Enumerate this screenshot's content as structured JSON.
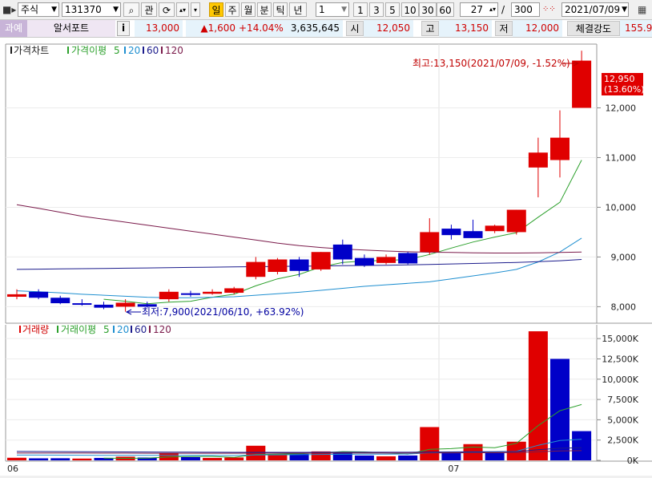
{
  "toolbar": {
    "market": "주식",
    "code": "131370",
    "btn_interest": "관",
    "periods": [
      "일",
      "주",
      "월",
      "분",
      "틱",
      "년"
    ],
    "interval_select": "1",
    "intervals": [
      "1",
      "3",
      "5",
      "10",
      "30",
      "60"
    ],
    "count_value": "27",
    "count_total": "300",
    "date": "2021/07/09"
  },
  "quote": {
    "badge": "과예",
    "name": "알서포트",
    "info": "i",
    "price": "13,000",
    "change": "▲1,600",
    "change_pct": "+14.04%",
    "volume": "3,635,645",
    "open_label": "시",
    "open": "12,050",
    "high_label": "고",
    "high": "13,150",
    "low_label": "저",
    "low": "12,000",
    "strength_label": "체결강도",
    "strength": "155.9"
  },
  "colors": {
    "up": "#e00000",
    "down": "#0000c8",
    "ma5": "#2ca02c",
    "ma20": "#1f8fd0",
    "ma60": "#1c1c8c",
    "ma120": "#7a1a4a"
  },
  "legends": {
    "price": {
      "title": "가격차트",
      "ma_label": "가격이평",
      "ma": [
        "5",
        "20",
        "60",
        "120"
      ]
    },
    "volume": {
      "title": "거래량",
      "ma_label": "거래이평",
      "ma": [
        "5",
        "20",
        "60",
        "120"
      ]
    }
  },
  "chart_data": [
    {
      "type": "candlestick",
      "title": "가격차트",
      "ylim": [
        7700,
        13250
      ],
      "y_ticks": [
        8000,
        9000,
        10000,
        11000,
        12000
      ],
      "y_tick_labels": [
        "8,000",
        "9,000",
        "10,000",
        "11,000",
        "12,000"
      ],
      "x_labels": [
        {
          "index": 0,
          "label": "06"
        },
        {
          "index": 20,
          "label": "07"
        }
      ],
      "last_price": "12,950",
      "last_pct": "(13.60%)",
      "annotation_high": "최고:13,150(2021/07/09, -1.52%)",
      "annotation_low": "최저:7,900(2021/06/10, +63.92%)",
      "candles": [
        {
          "o": 8200,
          "h": 8350,
          "l": 8150,
          "c": 8250
        },
        {
          "o": 8300,
          "h": 8350,
          "l": 8150,
          "c": 8180
        },
        {
          "o": 8180,
          "h": 8220,
          "l": 8050,
          "c": 8070
        },
        {
          "o": 8070,
          "h": 8150,
          "l": 8020,
          "c": 8040
        },
        {
          "o": 8040,
          "h": 8100,
          "l": 7950,
          "c": 7980
        },
        {
          "o": 8000,
          "h": 8150,
          "l": 7900,
          "c": 8080
        },
        {
          "o": 8050,
          "h": 8100,
          "l": 7980,
          "c": 8000
        },
        {
          "o": 8150,
          "h": 8350,
          "l": 8100,
          "c": 8300
        },
        {
          "o": 8270,
          "h": 8320,
          "l": 8200,
          "c": 8260
        },
        {
          "o": 8260,
          "h": 8350,
          "l": 8240,
          "c": 8300
        },
        {
          "o": 8280,
          "h": 8400,
          "l": 8250,
          "c": 8370
        },
        {
          "o": 8600,
          "h": 9000,
          "l": 8550,
          "c": 8900
        },
        {
          "o": 8700,
          "h": 8980,
          "l": 8650,
          "c": 8950
        },
        {
          "o": 8950,
          "h": 9000,
          "l": 8600,
          "c": 8720
        },
        {
          "o": 8750,
          "h": 9100,
          "l": 8720,
          "c": 9100
        },
        {
          "o": 9250,
          "h": 9350,
          "l": 8850,
          "c": 8950
        },
        {
          "o": 8980,
          "h": 9050,
          "l": 8800,
          "c": 8830
        },
        {
          "o": 8880,
          "h": 9050,
          "l": 8850,
          "c": 9000
        },
        {
          "o": 9080,
          "h": 9100,
          "l": 8850,
          "c": 8870
        },
        {
          "o": 9100,
          "h": 9780,
          "l": 9050,
          "c": 9500
        },
        {
          "o": 9570,
          "h": 9650,
          "l": 9350,
          "c": 9440
        },
        {
          "o": 9520,
          "h": 9750,
          "l": 9400,
          "c": 9380
        },
        {
          "o": 9520,
          "h": 9650,
          "l": 9480,
          "c": 9630
        },
        {
          "o": 9500,
          "h": 9950,
          "l": 9450,
          "c": 9950
        },
        {
          "o": 10800,
          "h": 11400,
          "l": 10200,
          "c": 11100
        },
        {
          "o": 10950,
          "h": 11950,
          "l": 10600,
          "c": 11400
        },
        {
          "o": 12000,
          "h": 13150,
          "l": 12000,
          "c": 12950
        }
      ],
      "series": [
        {
          "name": "5",
          "values": [
            null,
            null,
            null,
            null,
            8150,
            8110,
            8060,
            8090,
            8110,
            8190,
            8250,
            8420,
            8560,
            8650,
            8800,
            8890,
            8920,
            8930,
            8950,
            9050,
            9180,
            9300,
            9400,
            9490,
            9800,
            10100,
            10950
          ]
        },
        {
          "name": "20",
          "values": [
            8320,
            8300,
            8280,
            8250,
            8230,
            8210,
            8190,
            8180,
            8180,
            8190,
            8200,
            8230,
            8260,
            8290,
            8330,
            8370,
            8410,
            8440,
            8470,
            8500,
            8560,
            8620,
            8680,
            8750,
            8900,
            9100,
            9380
          ]
        },
        {
          "name": "60",
          "values": [
            8750,
            8755,
            8760,
            8765,
            8770,
            8775,
            8780,
            8785,
            8790,
            8795,
            8800,
            8805,
            8810,
            8815,
            8820,
            8825,
            8830,
            8835,
            8840,
            8850,
            8860,
            8870,
            8880,
            8890,
            8905,
            8925,
            8950
          ]
        },
        {
          "name": "120",
          "values": [
            10050,
            9980,
            9900,
            9820,
            9760,
            9700,
            9640,
            9580,
            9520,
            9460,
            9400,
            9340,
            9280,
            9230,
            9190,
            9160,
            9140,
            9120,
            9105,
            9095,
            9090,
            9085,
            9080,
            9080,
            9085,
            9090,
            9100
          ]
        }
      ]
    },
    {
      "type": "bar",
      "title": "거래량",
      "ylim": [
        0,
        16500
      ],
      "y_ticks": [
        0,
        2500,
        5000,
        7500,
        10000,
        12500,
        15000
      ],
      "y_tick_labels": [
        "0K",
        "2,500K",
        "5,000K",
        "7,500K",
        "10,000K",
        "12,500K",
        "15,000K"
      ],
      "bars": [
        {
          "v": 320,
          "up": true
        },
        {
          "v": 250,
          "up": false
        },
        {
          "v": 260,
          "up": false
        },
        {
          "v": 220,
          "up": true
        },
        {
          "v": 300,
          "up": false
        },
        {
          "v": 450,
          "up": true
        },
        {
          "v": 350,
          "up": false
        },
        {
          "v": 900,
          "up": true
        },
        {
          "v": 400,
          "up": false
        },
        {
          "v": 300,
          "up": true
        },
        {
          "v": 350,
          "up": true
        },
        {
          "v": 1800,
          "up": true
        },
        {
          "v": 700,
          "up": true
        },
        {
          "v": 800,
          "up": false
        },
        {
          "v": 1100,
          "up": true
        },
        {
          "v": 1000,
          "up": false
        },
        {
          "v": 600,
          "up": false
        },
        {
          "v": 500,
          "up": true
        },
        {
          "v": 600,
          "up": false
        },
        {
          "v": 4100,
          "up": true
        },
        {
          "v": 1000,
          "up": false
        },
        {
          "v": 2000,
          "up": true
        },
        {
          "v": 1000,
          "up": false
        },
        {
          "v": 2300,
          "up": true
        },
        {
          "v": 15900,
          "up": true
        },
        {
          "v": 12500,
          "up": false
        },
        {
          "v": 3600,
          "up": false
        }
      ],
      "series": [
        {
          "name": "5",
          "values": [
            null,
            null,
            null,
            null,
            270,
            250,
            280,
            420,
            460,
            480,
            380,
            720,
            760,
            820,
            930,
            1080,
            1040,
            920,
            760,
            1360,
            1440,
            1640,
            1550,
            2090,
            4280,
            6120,
            6880
          ]
        },
        {
          "name": "20",
          "values": [
            650,
            650,
            640,
            630,
            620,
            620,
            610,
            620,
            620,
            610,
            600,
            660,
            680,
            700,
            730,
            750,
            760,
            770,
            780,
            930,
            960,
            1020,
            1050,
            1120,
            1860,
            2450,
            2600
          ]
        },
        {
          "name": "60",
          "values": [
            1100,
            1090,
            1080,
            1060,
            1050,
            1040,
            1030,
            1020,
            1010,
            1000,
            990,
            990,
            990,
            990,
            1000,
            1000,
            1000,
            1000,
            1000,
            1030,
            1040,
            1060,
            1070,
            1090,
            1300,
            1490,
            1550
          ]
        },
        {
          "name": "120",
          "values": [
            900,
            900,
            900,
            895,
            890,
            885,
            880,
            880,
            880,
            880,
            880,
            885,
            885,
            890,
            890,
            895,
            895,
            895,
            900,
            920,
            925,
            935,
            940,
            950,
            1060,
            1160,
            1200
          ]
        }
      ]
    }
  ]
}
